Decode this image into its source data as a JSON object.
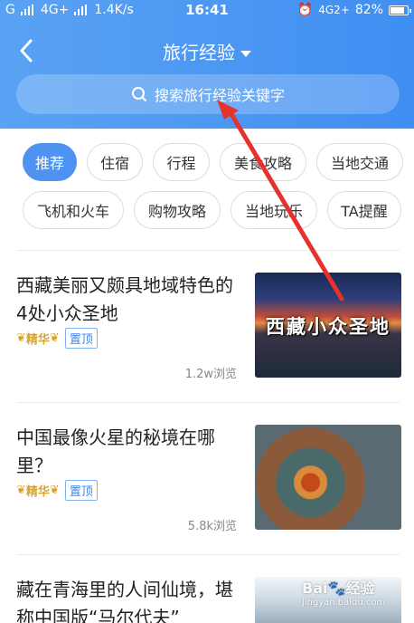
{
  "status": {
    "carrier_left": "G",
    "net_left": "4G+",
    "speed": "1.4K/s",
    "time": "16:41",
    "net_right": "4G2+",
    "battery": "82%",
    "battery_level": 0.82
  },
  "nav": {
    "title": "旅行经验",
    "search_placeholder": "搜索旅行经验关键字"
  },
  "tags": [
    {
      "label": "推荐",
      "active": true
    },
    {
      "label": "住宿"
    },
    {
      "label": "行程"
    },
    {
      "label": "美食攻略"
    },
    {
      "label": "当地交通"
    },
    {
      "label": "飞机和火车"
    },
    {
      "label": "购物攻略"
    },
    {
      "label": "当地玩乐"
    },
    {
      "label": "TA提醒"
    }
  ],
  "articles": [
    {
      "title": "西藏美丽又颇具地域特色的4处小众圣地",
      "badge_essence": "精华",
      "badge_top": "置顶",
      "views": "1.2w浏览",
      "thumb_text": "西藏小众圣地"
    },
    {
      "title": "中国最像火星的秘境在哪里？",
      "badge_essence": "精华",
      "badge_top": "置顶",
      "views": "5.8k浏览"
    },
    {
      "title": "藏在青海里的人间仙境，堪称中国版“马尔代夫”"
    }
  ],
  "watermark": {
    "main": "Bai🐾经验",
    "sub": "jingyan.baidu.com"
  },
  "colors": {
    "header": "#4a95f2",
    "active_tag": "#4f93f2",
    "badge_gold": "#d9a32a",
    "badge_blue": "#3c86e6",
    "arrow": "#e5322d"
  }
}
